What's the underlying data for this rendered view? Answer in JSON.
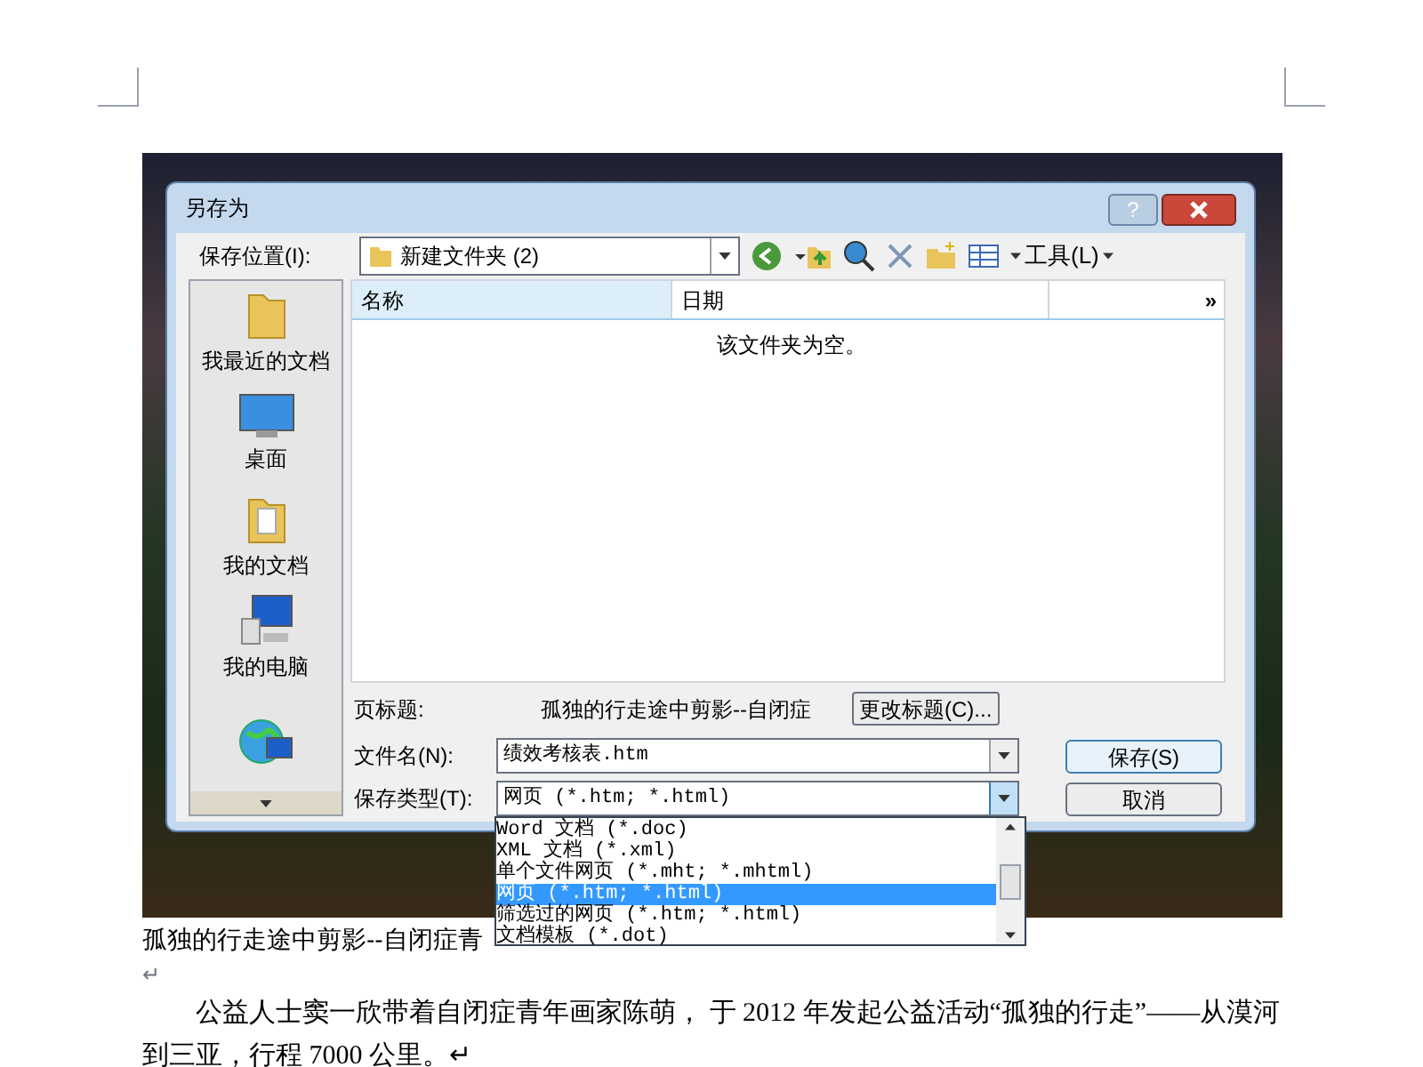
{
  "dialog": {
    "title": "另存为",
    "help": "?",
    "save_in_label": "保存位置(I):",
    "location": "新建文件夹 (2)",
    "tools": "工具(L)",
    "places": [
      {
        "label": "我最近的文档",
        "kind": "folder"
      },
      {
        "label": "桌面",
        "kind": "desktop"
      },
      {
        "label": "我的文档",
        "kind": "docs"
      },
      {
        "label": "我的电脑",
        "kind": "computer"
      },
      {
        "kind": "network"
      }
    ],
    "columns": [
      "名称",
      "日期"
    ],
    "more": "»",
    "empty_message": "该文件夹为空。",
    "page_title_label": "页标题:",
    "page_title": "孤独的行走途中剪影--自闭症",
    "change_title": "更改标题(C)...",
    "file_name_label": "文件名(N):",
    "file_name": "绩效考核表.htm",
    "file_type_label": "保存类型(T):",
    "file_type": "网页 (*.htm; *.html)",
    "buttons": [
      "保存(S)",
      "取消"
    ],
    "type_options": [
      {
        "label": "Word 文档 (*.doc)",
        "selected": false
      },
      {
        "label": "XML 文档 (*.xml)",
        "selected": false
      },
      {
        "label": "单个文件网页 (*.mht; *.mhtml)",
        "selected": false
      },
      {
        "label": "网页 (*.htm; *.html)",
        "selected": true
      },
      {
        "label": "筛选过的网页 (*.htm; *.html)",
        "selected": false
      },
      {
        "label": "文档模板 (*.dot)",
        "selected": false
      }
    ]
  },
  "document": {
    "caption": "孤独的行走途中剪影--自闭症青",
    "paragraphs": [
      "↵",
      "公益人士窦一欣带着自闭症青年画家陈萌， 于 2012 年发起公益活动“孤独的行走”——从漠河到三亚，行程 7000 公里。↵"
    ]
  }
}
